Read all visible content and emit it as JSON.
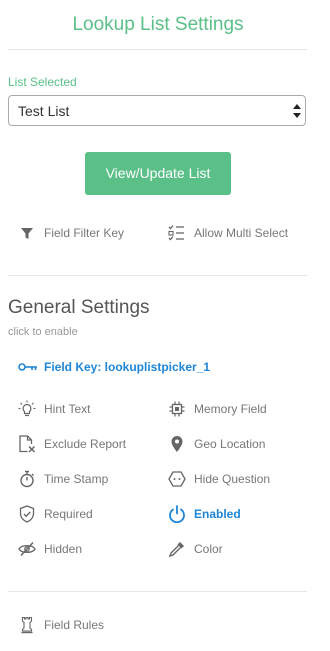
{
  "header": {
    "title": "Lookup List Settings"
  },
  "list_selection": {
    "label": "List Selected",
    "selected": "Test List"
  },
  "view_update_button": {
    "label": "View/Update List"
  },
  "list_options": {
    "field_filter_key": "Field Filter Key",
    "allow_multi_select": "Allow Multi Select"
  },
  "general_settings": {
    "title": "General Settings",
    "hint": "click to enable",
    "field_key": "Field Key: lookuplistpicker_1",
    "hint_text": "Hint Text",
    "memory_field": "Memory Field",
    "exclude_report": "Exclude Report",
    "geo_location": "Geo Location",
    "time_stamp": "Time Stamp",
    "hide_question": "Hide Question",
    "required": "Required",
    "enabled": "Enabled",
    "hidden": "Hidden",
    "color": "Color"
  },
  "rules": {
    "field_rules": "Field Rules"
  },
  "colors": {
    "accent_green": "#5bbf88",
    "active_blue": "#1f86d6",
    "text_gray": "#777777"
  }
}
